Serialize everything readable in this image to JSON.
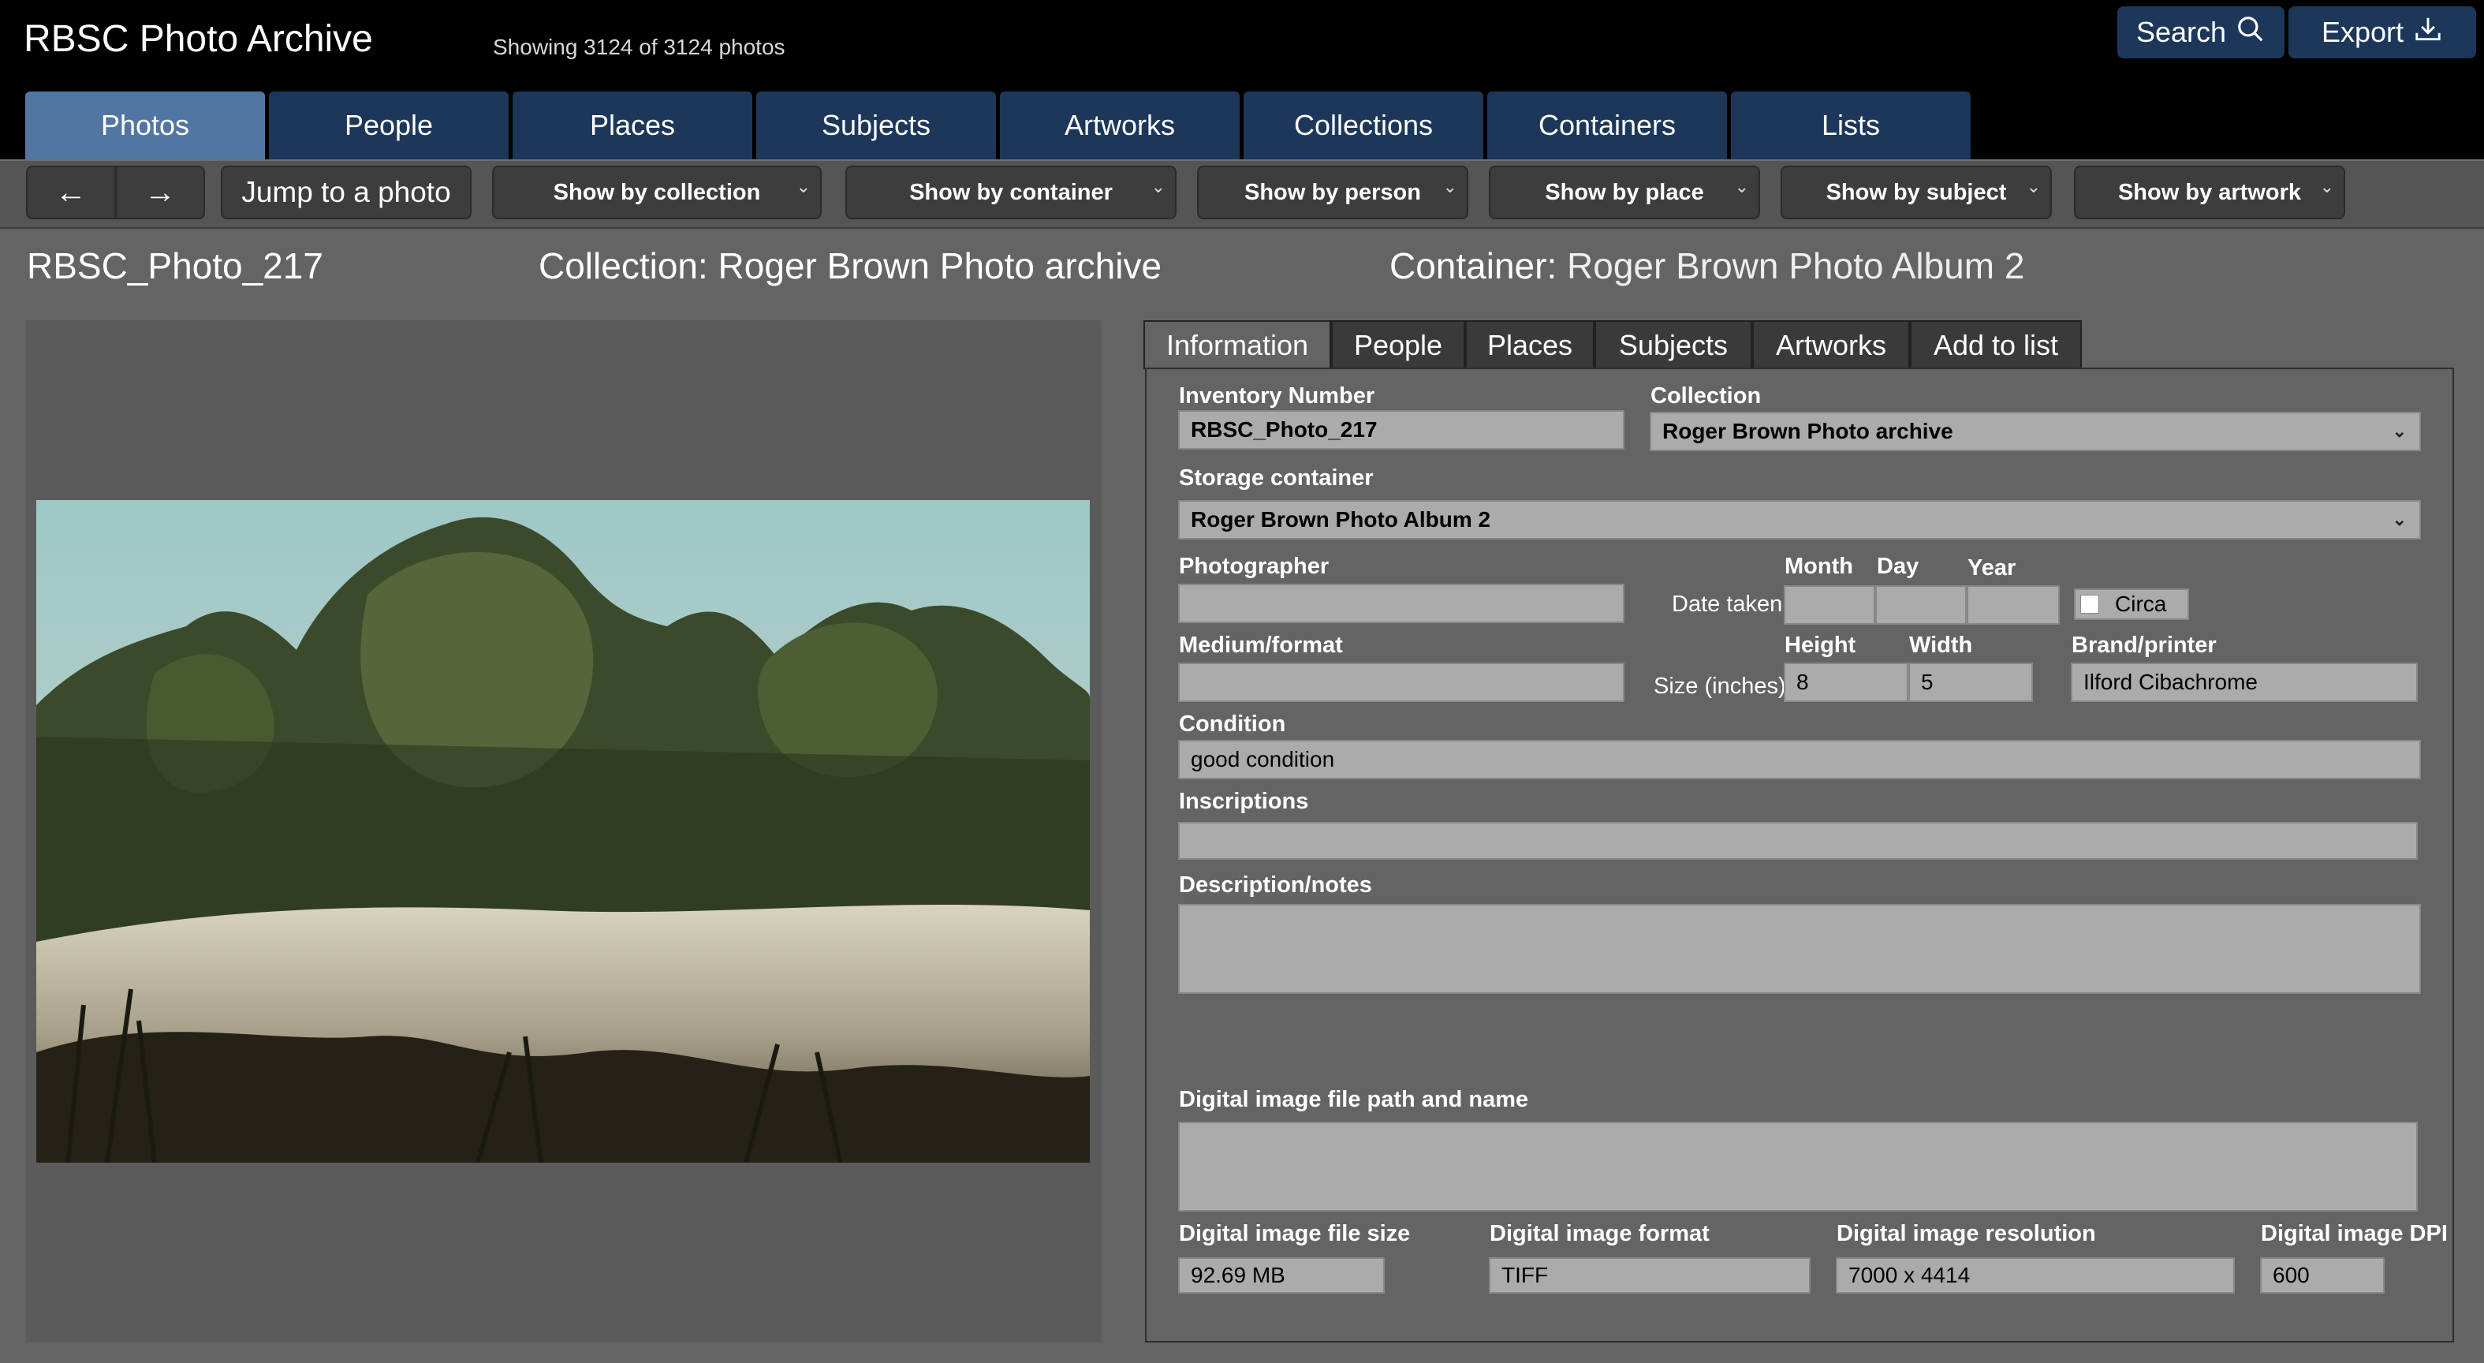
{
  "header": {
    "app_title": "RBSC Photo Archive",
    "showing": "Showing 3124 of 3124 photos",
    "search_label": "Search",
    "export_label": "Export"
  },
  "main_tabs": [
    "Photos",
    "People",
    "Places",
    "Subjects",
    "Artworks",
    "Collections",
    "Containers",
    "Lists"
  ],
  "active_main_tab": "Photos",
  "toolbar": {
    "prev": "←",
    "next": "→",
    "jump": "Jump to a photo",
    "filters": [
      "Show by collection",
      "Show by container",
      "Show by person",
      "Show by place",
      "Show by subject",
      "Show by artwork"
    ]
  },
  "record": {
    "photo_id": "RBSC_Photo_217",
    "collection_heading": "Collection: Roger Brown Photo archive",
    "container_heading_prefix": "Container:",
    "container_heading_value": "Roger Brown Photo Album 2"
  },
  "right_tabs": [
    "Information",
    "People",
    "Places",
    "Subjects",
    "Artworks",
    "Add to list"
  ],
  "active_right_tab": "Information",
  "form": {
    "inventory_label": "Inventory Number",
    "inventory_value": "RBSC_Photo_217",
    "collection_label": "Collection",
    "collection_value": "Roger Brown Photo archive",
    "storage_label": "Storage container",
    "storage_value": "Roger Brown Photo Album 2",
    "photographer_label": "Photographer",
    "photographer_value": "",
    "date_taken_label": "Date taken:",
    "month_label": "Month",
    "day_label": "Day",
    "year_label": "Year",
    "month_value": "",
    "day_value": "",
    "year_value": "",
    "circa_label": "Circa",
    "circa_checked": false,
    "medium_label": "Medium/format",
    "medium_value": "",
    "size_label": "Size (inches):",
    "height_label": "Height",
    "height_value": "8",
    "width_label": "Width",
    "width_value": "5",
    "brand_label": "Brand/printer",
    "brand_value": "Ilford Cibachrome",
    "condition_label": "Condition",
    "condition_value": "good condition",
    "inscriptions_label": "Inscriptions",
    "inscriptions_value": "",
    "description_label": "Description/notes",
    "description_value": "",
    "filepath_label": "Digital image file path and name",
    "filepath_value": "",
    "filesize_label": "Digital image file size",
    "filesize_value": "92.69 MB",
    "format_label": "Digital image format",
    "format_value": "TIFF",
    "resolution_label": "Digital image resolution",
    "resolution_value": "7000 x 4414",
    "dpi_label": "Digital image DPI",
    "dpi_value": "600"
  },
  "icons": {
    "search": "search-icon",
    "export": "export-icon",
    "dropdown": "chevron-down-icon"
  },
  "colors": {
    "tab_bg": "#1c3759",
    "tab_active": "#5276a3",
    "field_bg": "#ababab"
  }
}
